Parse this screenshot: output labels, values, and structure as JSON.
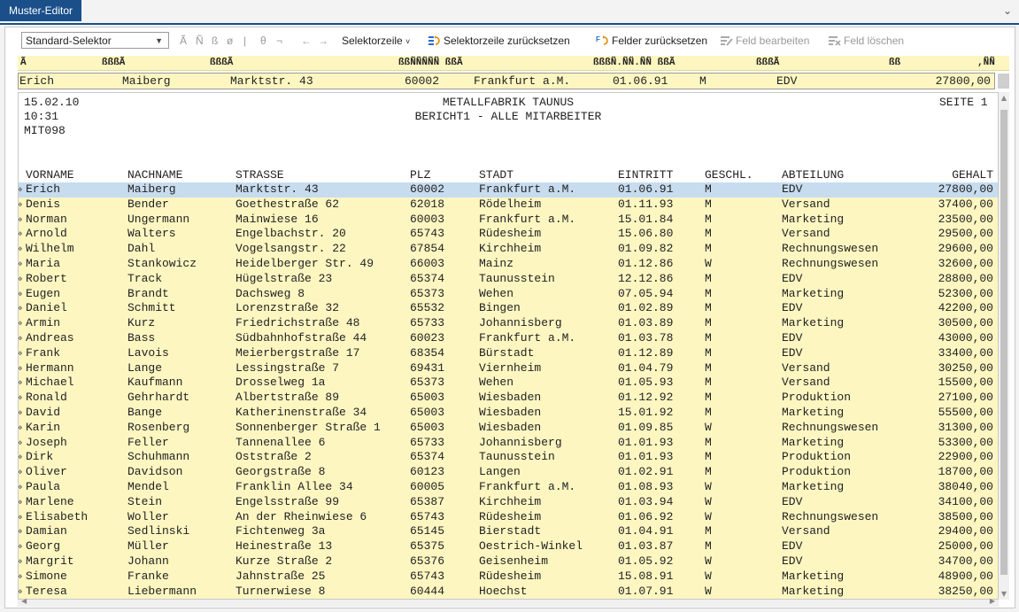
{
  "window": {
    "tab_title": "Muster-Editor",
    "tab_menu_icon": "chevron-down-icon"
  },
  "toolbar": {
    "selector": "Standard-Selektor",
    "glyph_buttons": [
      "Ã",
      "Ñ",
      "ß",
      "ø",
      "|",
      "θ",
      "¬",
      "←",
      "→"
    ],
    "selektorzeile": "Selektorzeile",
    "reset_selektorzeile": "Selektorzeile zurücksetzen",
    "reset_felder": "Felder zurücksetzen",
    "feld_bearbeiten": "Feld bearbeiten",
    "feld_loeschen": "Feld löschen",
    "icon_color_active": "#2a6ad3",
    "icon_color_accent": "#e08a00"
  },
  "mask": [
    "Ã",
    "ßßßÃ",
    "ßßßÃ",
    "ßßÑÑÑÑÑ ßßÃ",
    "ßßßÑ.ÑÑ.ÑÑ ßßÃ",
    "ßßßÃ",
    "ßß",
    ",ÑÑ"
  ],
  "selector_row": [
    "Erich",
    "Maiberg",
    "Marktstr. 43",
    "60002",
    "Frankfurt a.M.",
    "01.06.91",
    "M",
    "EDV",
    "27800,00"
  ],
  "report": {
    "date": "15.02.10",
    "time": "10:31",
    "code": "MIT098",
    "company": "METALLFABRIK TAUNUS",
    "title": "BERICHT1 - ALLE MITARBEITER",
    "page": "SEITE 1",
    "columns": [
      "VORNAME",
      "NACHNAME",
      "STRASSE",
      "PLZ",
      "STADT",
      "EINTRITT",
      "GESCHL.",
      "ABTEILUNG",
      "GEHALT"
    ],
    "row_marker": "»",
    "rows": [
      [
        "Erich",
        "Maiberg",
        "Marktstr. 43",
        "60002",
        "Frankfurt a.M.",
        "01.06.91",
        "M",
        "EDV",
        "27800,00"
      ],
      [
        "Denis",
        "Bender",
        "Goethestraße 62",
        "62018",
        "Rödelheim",
        "01.11.93",
        "M",
        "Versand",
        "37400,00"
      ],
      [
        "Norman",
        "Ungermann",
        "Mainwiese 16",
        "60003",
        "Frankfurt a.M.",
        "15.01.84",
        "M",
        "Marketing",
        "23500,00"
      ],
      [
        "Arnold",
        "Walters",
        "Engelbachstr. 20",
        "65743",
        "Rüdesheim",
        "15.06.80",
        "M",
        "Versand",
        "29500,00"
      ],
      [
        "Wilhelm",
        "Dahl",
        "Vogelsangstr. 22",
        "67854",
        "Kirchheim",
        "01.09.82",
        "M",
        "Rechnungswesen",
        "29600,00"
      ],
      [
        "Maria",
        "Stankowicz",
        "Heidelberger Str. 49",
        "66003",
        "Mainz",
        "01.12.86",
        "W",
        "Rechnungswesen",
        "32600,00"
      ],
      [
        "Robert",
        "Track",
        "Hügelstraße 23",
        "65374",
        "Taunusstein",
        "12.12.86",
        "M",
        "EDV",
        "28800,00"
      ],
      [
        "Eugen",
        "Brandt",
        "Dachsweg 8",
        "65373",
        "Wehen",
        "07.05.94",
        "M",
        "Marketing",
        "52300,00"
      ],
      [
        "Daniel",
        "Schmitt",
        "Lorenzstraße 32",
        "65532",
        "Bingen",
        "01.02.89",
        "M",
        "EDV",
        "42200,00"
      ],
      [
        "Armin",
        "Kurz",
        "Friedrichstraße 48",
        "65733",
        "Johannisberg",
        "01.03.89",
        "M",
        "Marketing",
        "30500,00"
      ],
      [
        "Andreas",
        "Bass",
        "Südbahnhofstraße 44",
        "60023",
        "Frankfurt a.M.",
        "01.03.78",
        "M",
        "EDV",
        "43000,00"
      ],
      [
        "Frank",
        "Lavois",
        "Meierbergstraße 17",
        "68354",
        "Bürstadt",
        "01.12.89",
        "M",
        "EDV",
        "33400,00"
      ],
      [
        "Hermann",
        "Lange",
        "Lessingstraße 7",
        "69431",
        "Viernheim",
        "01.04.79",
        "M",
        "Versand",
        "30250,00"
      ],
      [
        "Michael",
        "Kaufmann",
        "Drosselweg 1a",
        "65373",
        "Wehen",
        "01.05.93",
        "M",
        "Versand",
        "15500,00"
      ],
      [
        "Ronald",
        "Gehrhardt",
        "Albertstraße 89",
        "65003",
        "Wiesbaden",
        "01.12.92",
        "M",
        "Produktion",
        "27100,00"
      ],
      [
        "David",
        "Bange",
        "Katherinenstraße 34",
        "65003",
        "Wiesbaden",
        "15.01.92",
        "M",
        "Marketing",
        "55500,00"
      ],
      [
        "Karin",
        "Rosenberg",
        "Sonnenberger Straße 1",
        "65003",
        "Wiesbaden",
        "01.09.85",
        "W",
        "Rechnungswesen",
        "31300,00"
      ],
      [
        "Joseph",
        "Feller",
        "Tannenallee 6",
        "65733",
        "Johannisberg",
        "01.01.93",
        "M",
        "Marketing",
        "53300,00"
      ],
      [
        "Dirk",
        "Schuhmann",
        "Oststraße 2",
        "65374",
        "Taunusstein",
        "01.01.93",
        "M",
        "Produktion",
        "22900,00"
      ],
      [
        "Oliver",
        "Davidson",
        "Georgstraße 8",
        "60123",
        "Langen",
        "01.02.91",
        "M",
        "Produktion",
        "18700,00"
      ],
      [
        "Paula",
        "Mendel",
        "Franklin Allee 34",
        "60005",
        "Frankfurt a.M.",
        "01.08.93",
        "W",
        "Marketing",
        "38040,00"
      ],
      [
        "Marlene",
        "Stein",
        "Engelsstraße 99",
        "65387",
        "Kirchheim",
        "01.03.94",
        "W",
        "EDV",
        "34100,00"
      ],
      [
        "Elisabeth",
        "Woller",
        "An der Rheinwiese 6",
        "65743",
        "Rüdesheim",
        "01.06.92",
        "W",
        "Rechnungswesen",
        "38500,00"
      ],
      [
        "Damian",
        "Sedlinski",
        "Fichtenweg 3a",
        "65145",
        "Bierstadt",
        "01.04.91",
        "M",
        "Versand",
        "29400,00"
      ],
      [
        "Georg",
        "Müller",
        "Heinestraße 13",
        "65375",
        "Oestrich-Winkel",
        "01.03.87",
        "M",
        "EDV",
        "25000,00"
      ],
      [
        "Margrit",
        "Johann",
        "Kurze Straße 2",
        "65376",
        "Geisenheim",
        "01.05.92",
        "W",
        "EDV",
        "34700,00"
      ],
      [
        "Simone",
        "Franke",
        "Jahnstraße 25",
        "65743",
        "Rüdesheim",
        "15.08.91",
        "W",
        "Marketing",
        "48900,00"
      ],
      [
        "Teresa",
        "Liebermann",
        "Turnerwiese 8",
        "60444",
        "Hoechst",
        "01.07.91",
        "W",
        "Marketing",
        "38250,00"
      ]
    ],
    "selected_row_index": 0,
    "row_bg": "#fdf6c1",
    "selected_bg": "#c7dcef"
  }
}
